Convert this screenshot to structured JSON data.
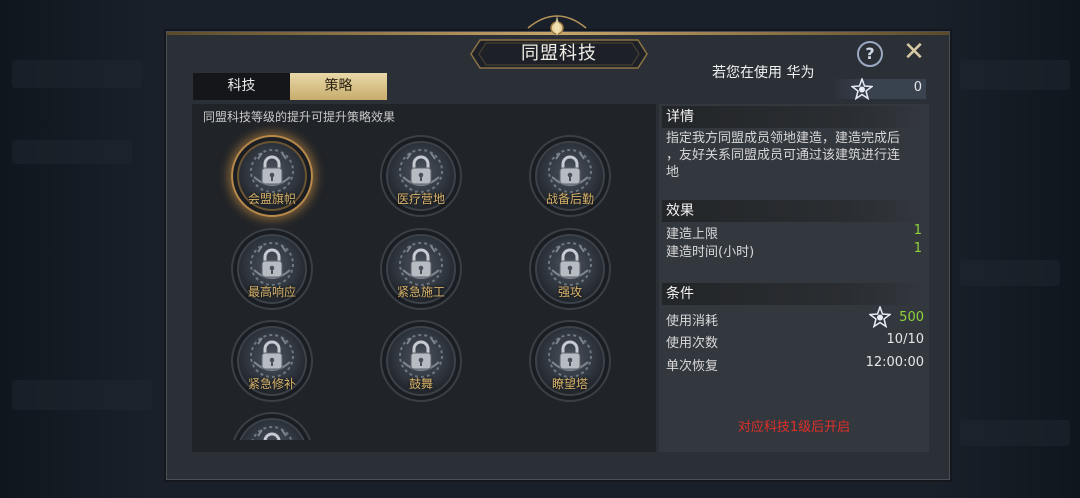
{
  "window": {
    "title": "同盟科技"
  },
  "tabs": [
    {
      "label": "科技",
      "active": false
    },
    {
      "label": "策略",
      "active": true
    }
  ],
  "notice": "若您在使用 华为",
  "resource": {
    "icon": "star-crystal-icon",
    "amount": "0"
  },
  "left": {
    "description": "同盟科技等级的提升可提升策略效果",
    "nodes": [
      {
        "label": "会盟旗帜",
        "selected": true
      },
      {
        "label": "医疗营地",
        "selected": false
      },
      {
        "label": "战备后勤",
        "selected": false
      },
      {
        "label": "最高响应",
        "selected": false
      },
      {
        "label": "紧急施工",
        "selected": false
      },
      {
        "label": "强攻",
        "selected": false
      },
      {
        "label": "紧急修补",
        "selected": false
      },
      {
        "label": "鼓舞",
        "selected": false
      },
      {
        "label": "瞭望塔",
        "selected": false
      },
      {
        "label": "",
        "selected": false
      }
    ]
  },
  "details": {
    "heading": "详情",
    "text_lines": [
      "指定我方同盟成员领地建造，建造完成后",
      "，友好关系同盟成员可通过该建筑进行连",
      "地"
    ]
  },
  "effects": {
    "heading": "效果",
    "rows": [
      {
        "label": "建造上限",
        "value": "1"
      },
      {
        "label": "建造时间(小时)",
        "value": "1"
      }
    ]
  },
  "conditions": {
    "heading": "条件",
    "cost_label": "使用消耗",
    "cost_value": "500",
    "uses_label": "使用次数",
    "uses_value": "10/10",
    "recover_label": "单次恢复",
    "recover_value": "12:00:00"
  },
  "unlock_text": "对应科技1级后开启",
  "colors": {
    "accent_gold": "#c9a56a",
    "value_green": "#8fd43a",
    "warning_red": "#e0302a"
  }
}
